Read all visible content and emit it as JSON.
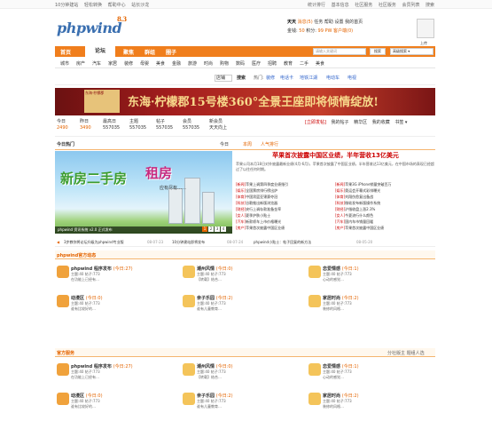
{
  "topbar": {
    "left": [
      "10分钟建站",
      "轻松转换",
      "帮助中心",
      "站长沙龙"
    ],
    "right": [
      "统计排行",
      "基本信息",
      "社区服务",
      "社区版务",
      "会员列表",
      "搜索"
    ]
  },
  "logo": {
    "text": "phpwind",
    "version": "8.3"
  },
  "user": {
    "line1": "天天",
    "news": "消息(5)",
    "task": "任务",
    "help": "帮助",
    "settings": "设置",
    "account": "我的首页",
    "points_label": "金钱:",
    "points": "50",
    "posts_label": "积分:",
    "posts": "99",
    "pw": "PW 客户端(0)",
    "avatar_label": "上传"
  },
  "nav": {
    "items": [
      "首页",
      "论坛",
      "聚焦",
      "群组",
      "圈子"
    ],
    "current": "论坛",
    "search_placeholder": "请输入关键词",
    "search_button": "搜索",
    "advanced": "高级搜索 ▾"
  },
  "subnav": [
    "城市",
    "房产",
    "汽车",
    "家居",
    "装修",
    "母婴",
    "美食",
    "金融",
    "旅游",
    "时尚",
    "购物",
    "数码",
    "医疗",
    "招聘",
    "教育",
    "二手",
    "美食"
  ],
  "pathbar": {
    "select": "店铺",
    "search_btn": "搜索",
    "hot_label": "热门:",
    "hot": [
      "装修",
      "电话卡",
      "地铁江湖",
      "电动车",
      "电视"
    ]
  },
  "banner": {
    "box": "东海·柠檬郡",
    "text": "东海·柠檬郡15号楼360°全景王座即将倾情绽放!"
  },
  "stats": [
    {
      "label": "今日",
      "value": "2490"
    },
    {
      "label": "昨日",
      "value": "3490"
    },
    {
      "label": "最高日",
      "value": "557035"
    },
    {
      "label": "主题",
      "value": "557035"
    },
    {
      "label": "帖子",
      "value": "557035"
    },
    {
      "label": "会员",
      "value": "557035"
    },
    {
      "label": "新会员",
      "value": "天天向上"
    }
  ],
  "statlinks": [
    "[立即发帖]",
    "我的帖子",
    "精华区",
    "我的收藏",
    "书签 ▾"
  ],
  "tabs": {
    "left": "今日热门",
    "right": [
      "今日",
      "本周",
      "人气排行"
    ]
  },
  "photo": {
    "big1": "新房二手房",
    "big2": "租房",
    "sub": "应有尽有……",
    "caption": "phpwind 资讯系统 v2.0 正式发布",
    "pages": [
      "1",
      "2",
      "3",
      "4"
    ]
  },
  "news": {
    "headline": "苹果首次披露中国区业绩，半年营收13亿美元",
    "summary": "苹果公司本月18日对外披露最新业绩(4月-6月)，苹果首次披露了中国区业绩，半年营收达13亿美元，在中国市场的表现已经超过了以往任何时期。",
    "rows": [
      [
        {
          "c": "[新闻]",
          "t": "苹果上调第四季度业绩指引"
        },
        {
          "c": "[新闻]",
          "t": "苹果3G iPhone销量突破百万"
        }
      ],
      [
        {
          "c": "[娱乐]",
          "t": "全国票房排行榜出炉"
        },
        {
          "c": "[娱乐]",
          "t": "奥运会开幕式彩排曝光"
        }
      ],
      [
        {
          "c": "[体育]",
          "t": "中国男篮亚锦赛夺冠"
        },
        {
          "c": "[体育]",
          "t": "刘翔伤愈复出备战"
        }
      ],
      [
        {
          "c": "[科技]",
          "t": "谷歌推出新版浏览器"
        },
        {
          "c": "[科技]",
          "t": "微软发布新版操作系统"
        }
      ],
      [
        {
          "c": "[财经]",
          "t": "央行上调存款准备金率"
        },
        {
          "c": "[财经]",
          "t": "沪指收盘上涨2.3%"
        }
      ],
      [
        {
          "c": "[女人]",
          "t": "夏季护肤小贴士"
        },
        {
          "c": "[女人]",
          "t": "今夏流行什么颜色"
        }
      ],
      [
        {
          "c": "[汽车]",
          "t": "新款轿车上市价格曝光"
        },
        {
          "c": "[汽车]",
          "t": "国内车市销量回暖"
        }
      ],
      [
        {
          "c": "[房产]",
          "t": "苹果首次披露中国区业绩"
        },
        {
          "c": "[房产]",
          "t": "苹果首次披露中国区业绩"
        }
      ]
    ]
  },
  "ticker": [
    "3步教你将论坛升级为phpwind专业版",
    "10分钟建站即将发布",
    "phpwind小贴士：帖子回复的新方法"
  ],
  "ticker_dates": [
    "08-07-23",
    "08-07-24",
    "08-05-20"
  ],
  "section1": {
    "title": "phpwind官方动态"
  },
  "section2": {
    "title": "官方服务",
    "right": "分社版主 题组人选"
  },
  "cards": [
    {
      "title": "phpwind 程序发布",
      "today": "(今日:27)",
      "meta": "主题:40  帖子:773",
      "last": "在功能上已经有…"
    },
    {
      "title": "潮州风情",
      "today": "(今日:0)",
      "meta": "主题:40  帖子:773",
      "last": "【转载】结合…"
    },
    {
      "title": "恋爱情感",
      "today": "(今日:1)",
      "meta": "主题:40  帖子:773",
      "last": "心动的感觉…"
    },
    {
      "title": "动漫区",
      "today": "(今日:0)",
      "meta": "主题:40  帖子:773",
      "last": "谁有比较好的…"
    },
    {
      "title": "亲子乐园",
      "today": "(今日:2)",
      "meta": "主题:40  帖子:773",
      "last": "谁有儿童教育…"
    },
    {
      "title": "家居时尚",
      "today": "(今日:2)",
      "meta": "主题:40  帖子:773",
      "last": "装修的风格…"
    },
    {
      "title": "phpwind 程序发布",
      "today": "(今日:27)",
      "meta": "主题:40  帖子:773",
      "last": "在功能上已经有…"
    },
    {
      "title": "潮州风情",
      "today": "(今日:0)",
      "meta": "主题:40  帖子:773",
      "last": "【转载】结合…"
    },
    {
      "title": "恋爱情感",
      "today": "(今日:1)",
      "meta": "主题:40  帖子:773",
      "last": "心动的感觉…"
    },
    {
      "title": "动漫区",
      "today": "(今日:0)",
      "meta": "主题:40  帖子:773",
      "last": "谁有比较好的…"
    },
    {
      "title": "亲子乐园",
      "today": "(今日:2)",
      "meta": "主题:40  帖子:773",
      "last": "谁有儿童教育…"
    },
    {
      "title": "家居时尚",
      "today": "(今日:2)",
      "meta": "主题:40  帖子:773",
      "last": "装修的风格…"
    }
  ],
  "colors": {
    "accent": "#f07e1c",
    "link_red": "#cc0000",
    "logo": "#3a6fb0"
  }
}
